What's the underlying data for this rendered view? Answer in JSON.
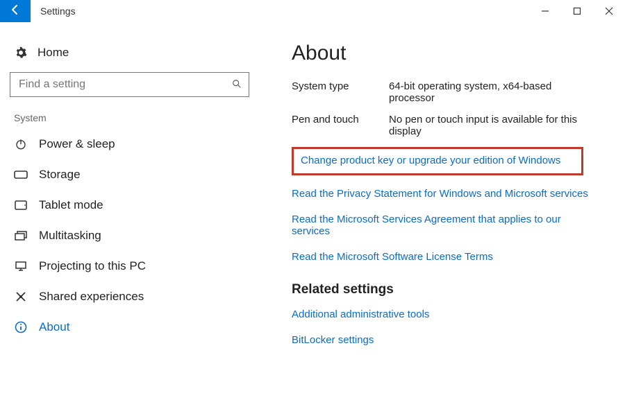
{
  "window": {
    "title": "Settings"
  },
  "sidebar": {
    "home_label": "Home",
    "search_placeholder": "Find a setting",
    "category_label": "System",
    "items": [
      {
        "label": "Power & sleep"
      },
      {
        "label": "Storage"
      },
      {
        "label": "Tablet mode"
      },
      {
        "label": "Multitasking"
      },
      {
        "label": "Projecting to this PC"
      },
      {
        "label": "Shared experiences"
      },
      {
        "label": "About"
      }
    ]
  },
  "main": {
    "title": "About",
    "info": [
      {
        "key": "System type",
        "val": "64-bit operating system, x64-based processor"
      },
      {
        "key": "Pen and touch",
        "val": "No pen or touch input is available for this display"
      }
    ],
    "links": [
      "Change product key or upgrade your edition of Windows",
      "Read the Privacy Statement for Windows and Microsoft services",
      "Read the Microsoft Services Agreement that applies to our services",
      "Read the Microsoft Software License Terms"
    ],
    "related_title": "Related settings",
    "related_links": [
      "Additional administrative tools",
      "BitLocker settings"
    ]
  }
}
